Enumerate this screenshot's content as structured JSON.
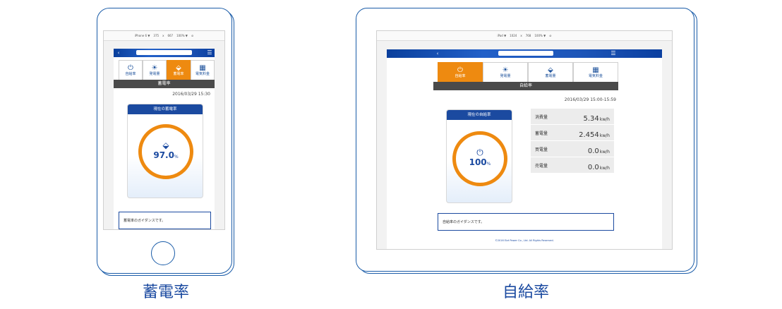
{
  "phone": {
    "devtools": {
      "device": "iPhone 6 ▼",
      "width": "375",
      "x": "x",
      "height": "667",
      "zoom": "100% ▼",
      "rotate": "⊘"
    },
    "nav": {
      "back": "‹",
      "menu": "☰"
    },
    "tabs": [
      {
        "label": "自給率",
        "icon": "⏻",
        "icon_name": "power-icon"
      },
      {
        "label": "発電量",
        "icon": "☀",
        "icon_name": "bulb-icon"
      },
      {
        "label": "蓄電率",
        "icon": "⬙",
        "icon_name": "battery-icon"
      },
      {
        "label": "電気料金",
        "icon": "▦",
        "icon_name": "bill-icon"
      }
    ],
    "active_tab": 2,
    "section_title": "蓄電率",
    "timestamp": "2016/03/29 15:30",
    "card_title": "現在の蓄電率",
    "ring_icon": "⬙",
    "ring_value": "97.0",
    "ring_unit": "%",
    "guide_text": "蓄電率のガイダンスです。"
  },
  "tablet": {
    "devtools": {
      "device": "iPad ▼",
      "width": "1024",
      "x": "x",
      "height": "768",
      "zoom": "100% ▼",
      "rotate": "⊘"
    },
    "nav": {
      "back": "‹",
      "menu": "☰"
    },
    "tabs": [
      {
        "label": "自給率",
        "icon": "⏻",
        "icon_name": "power-icon"
      },
      {
        "label": "発電量",
        "icon": "☀",
        "icon_name": "bulb-icon"
      },
      {
        "label": "蓄電量",
        "icon": "⬙",
        "icon_name": "battery-icon"
      },
      {
        "label": "電気料金",
        "icon": "▦",
        "icon_name": "bill-icon"
      }
    ],
    "active_tab": 0,
    "section_title": "自給率",
    "timestamp": "2016/03/29 15:00-15:59",
    "card_title": "現在の自給率",
    "ring_icon": "⏻",
    "ring_value": "100",
    "ring_unit": "%",
    "stats": [
      {
        "label": "消費量",
        "value": "5.34",
        "unit": "kw/h"
      },
      {
        "label": "蓄電量",
        "value": "2.454",
        "unit": "kw/h"
      },
      {
        "label": "買電量",
        "value": "0.0",
        "unit": "kw/h"
      },
      {
        "label": "売電量",
        "value": "0.0",
        "unit": "kw/h"
      }
    ],
    "guide_text": "自給率のガイダンスです。",
    "footer": "©2016 Eizt Power Co., Ltd. All Rights Reserved."
  },
  "captions": {
    "phone": "蓄電率",
    "tablet": "自給率"
  },
  "colors": {
    "brand_blue": "#1b4aa0",
    "accent_orange": "#ee8a10",
    "section_bar": "#4a4a4a"
  }
}
